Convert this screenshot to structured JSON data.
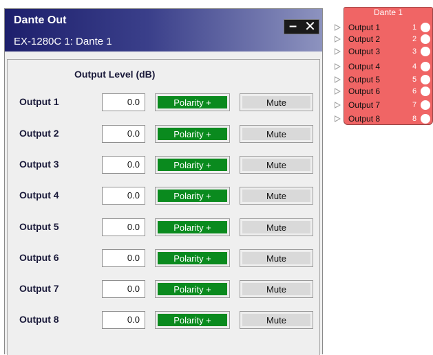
{
  "window": {
    "title": "Dante Out",
    "subtitle": "EX-1280C 1: Dante 1"
  },
  "panel": {
    "level_header": "Output Level (dB)",
    "rows": [
      {
        "label": "Output 1",
        "level": "0.0",
        "polarity": "Polarity +",
        "mute": "Mute"
      },
      {
        "label": "Output 2",
        "level": "0.0",
        "polarity": "Polarity +",
        "mute": "Mute"
      },
      {
        "label": "Output 3",
        "level": "0.0",
        "polarity": "Polarity +",
        "mute": "Mute"
      },
      {
        "label": "Output 4",
        "level": "0.0",
        "polarity": "Polarity +",
        "mute": "Mute"
      },
      {
        "label": "Output 5",
        "level": "0.0",
        "polarity": "Polarity +",
        "mute": "Mute"
      },
      {
        "label": "Output 6",
        "level": "0.0",
        "polarity": "Polarity +",
        "mute": "Mute"
      },
      {
        "label": "Output 7",
        "level": "0.0",
        "polarity": "Polarity +",
        "mute": "Mute"
      },
      {
        "label": "Output 8",
        "level": "0.0",
        "polarity": "Polarity +",
        "mute": "Mute"
      }
    ]
  },
  "block": {
    "title": "Dante 1",
    "outputs": [
      {
        "name": "Output 1",
        "num": "1"
      },
      {
        "name": "Output 2",
        "num": "2"
      },
      {
        "name": "Output 3",
        "num": "3"
      },
      {
        "name": "Output 4",
        "num": "4"
      },
      {
        "name": "Output 5",
        "num": "5"
      },
      {
        "name": "Output 6",
        "num": "6"
      },
      {
        "name": "Output 7",
        "num": "7"
      },
      {
        "name": "Output 8",
        "num": "8"
      }
    ]
  },
  "colors": {
    "polarity_active": "#0a8a1e",
    "block_fill": "#f06565",
    "titlebar": "#1d1f6c"
  }
}
